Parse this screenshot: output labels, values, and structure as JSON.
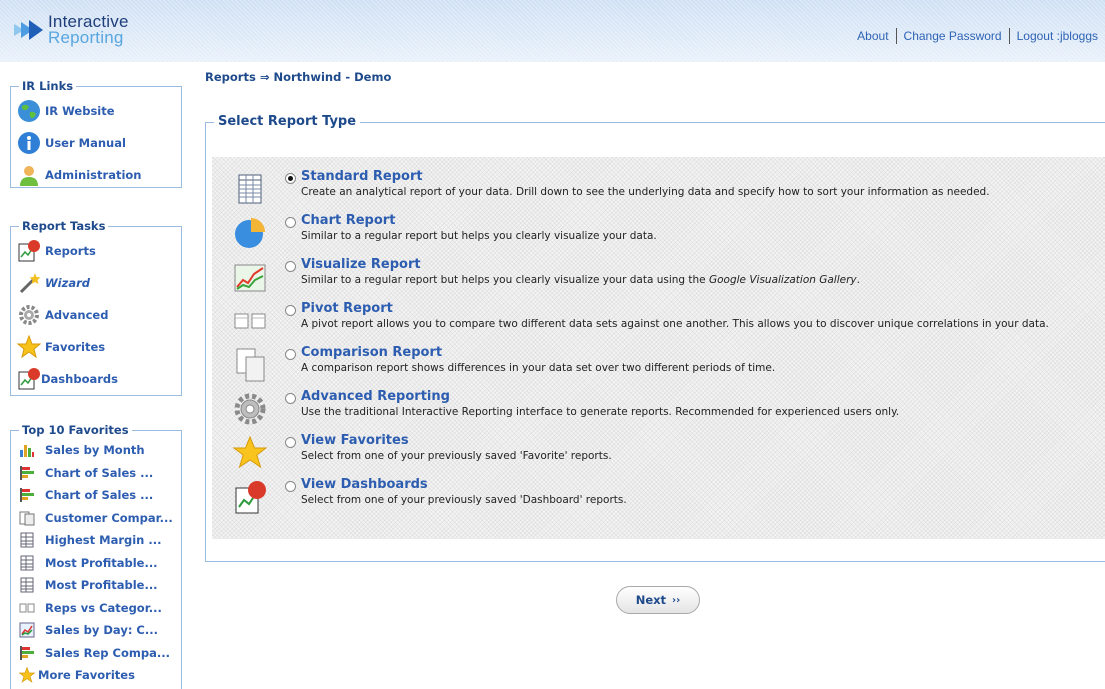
{
  "header": {
    "logo_line1": "Interactive",
    "logo_line2": "Reporting",
    "links": {
      "about": "About",
      "change_password": "Change Password",
      "logout": "Logout :jbloggs"
    }
  },
  "sidebar": {
    "ir_links": {
      "title": "IR Links",
      "items": [
        {
          "label": "IR Website",
          "icon": "globe-icon"
        },
        {
          "label": "User Manual",
          "icon": "info-icon"
        },
        {
          "label": "Administration",
          "icon": "user-icon"
        }
      ]
    },
    "report_tasks": {
      "title": "Report Tasks",
      "items": [
        {
          "label": "Reports",
          "icon": "reports-icon"
        },
        {
          "label": "Wizard",
          "icon": "wizard-icon"
        },
        {
          "label": "Advanced",
          "icon": "gears-icon"
        },
        {
          "label": "Favorites",
          "icon": "star-icon"
        },
        {
          "label": "Dashboards",
          "icon": "dashboard-icon"
        }
      ]
    },
    "favorites": {
      "title": "Top 10 Favorites",
      "items": [
        {
          "label": "Sales by Month",
          "icon": "bar-chart-icon"
        },
        {
          "label": "Chart of Sales ...",
          "icon": "hbar-chart-icon"
        },
        {
          "label": "Chart of Sales ...",
          "icon": "hbar-chart-icon"
        },
        {
          "label": "Customer Compar...",
          "icon": "comparison-icon"
        },
        {
          "label": "Highest Margin ...",
          "icon": "table-icon"
        },
        {
          "label": "Most Profitable...",
          "icon": "table-icon"
        },
        {
          "label": "Most Profitable...",
          "icon": "table-icon"
        },
        {
          "label": "Reps vs Categor...",
          "icon": "pivot-icon"
        },
        {
          "label": "Sales by Day: C...",
          "icon": "line-chart-icon"
        },
        {
          "label": "Sales Rep Compa...",
          "icon": "hbar-chart-icon"
        }
      ],
      "more": "More Favorites"
    }
  },
  "breadcrumb": {
    "root": "Reports",
    "arrow": "⇒",
    "current": "Northwind - Demo"
  },
  "main": {
    "panel_title": "Select Report Type",
    "selected": "Standard Report",
    "options": [
      {
        "title": "Standard Report",
        "desc": "Create an analytical report of your data. Drill down to see the underlying data and specify how to sort your information as needed.",
        "icon": "standard-report-icon"
      },
      {
        "title": "Chart Report",
        "desc": "Similar to a regular report but helps you clearly visualize your data.",
        "icon": "pie-chart-icon"
      },
      {
        "title": "Visualize Report",
        "desc": "Similar to a regular report but helps you clearly visualize your data using the ",
        "desc_italic": "Google Visualization Gallery",
        "desc_after": ".",
        "icon": "visualize-icon"
      },
      {
        "title": "Pivot Report",
        "desc": "A pivot report allows you to compare two different data sets against one another. This allows you to discover unique correlations in your data.",
        "icon": "pivot-icon"
      },
      {
        "title": "Comparison Report",
        "desc": "A comparison report shows differences in your data set over two different periods of time.",
        "icon": "comparison-icon"
      },
      {
        "title": "Advanced Reporting",
        "desc": "Use the traditional Interactive Reporting interface to generate reports. Recommended for experienced users only.",
        "icon": "gears-icon"
      },
      {
        "title": "View Favorites",
        "desc": "Select from one of your previously saved 'Favorite' reports.",
        "icon": "star-icon"
      },
      {
        "title": "View Dashboards",
        "desc": "Select from one of your previously saved 'Dashboard' reports.",
        "icon": "dashboard-icon"
      }
    ],
    "next_label": "Next",
    "next_arrows": "››"
  },
  "colors": {
    "link": "#2d5db0",
    "heading": "#1e4a8c",
    "border": "#9cbbe0"
  }
}
